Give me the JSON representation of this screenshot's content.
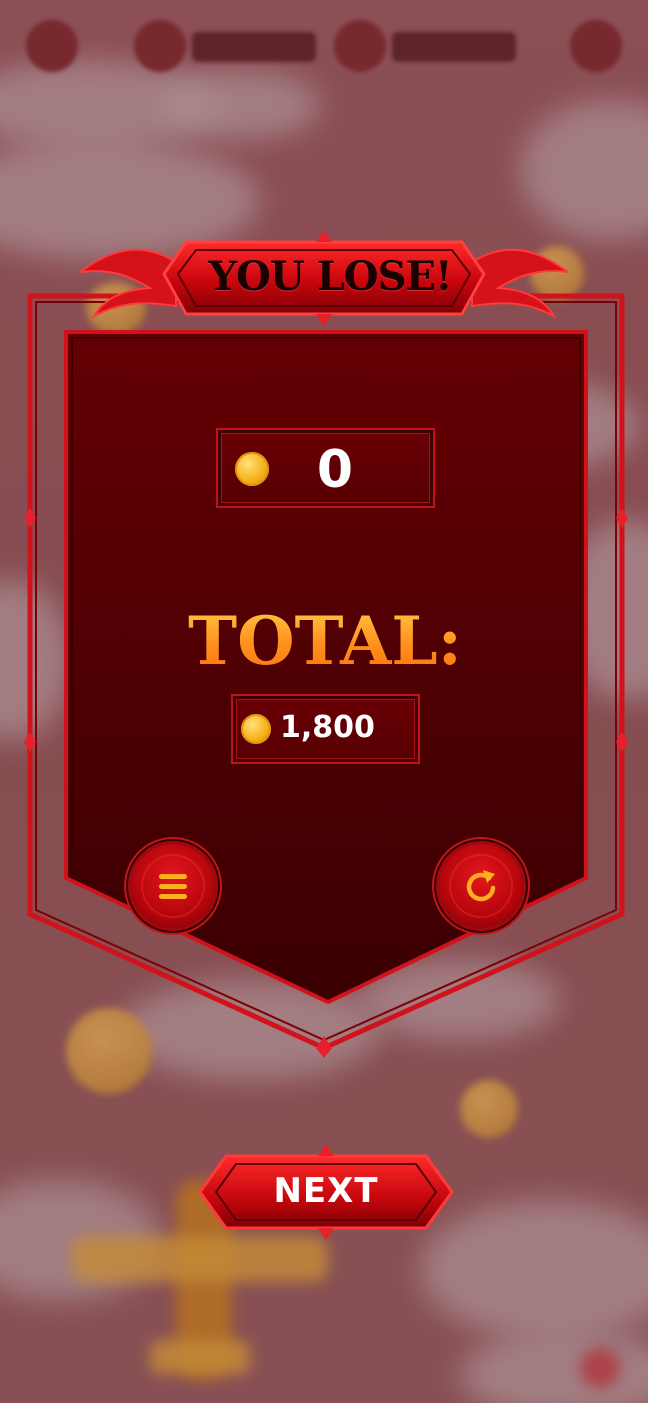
{
  "popup": {
    "title": "YOU LOSE!",
    "score_value": "0",
    "total_label": "TOTAL:",
    "total_value": "1,800"
  },
  "buttons": {
    "menu_icon": "menu-icon",
    "restart_icon": "restart-icon",
    "next_label": "NEXT"
  },
  "colors": {
    "panel": "#5a0004",
    "frame": "#d1121a",
    "total_gradient_top": "#ffd24a",
    "total_gradient_bottom": "#ff6a10",
    "coin": "#f7b01a"
  }
}
